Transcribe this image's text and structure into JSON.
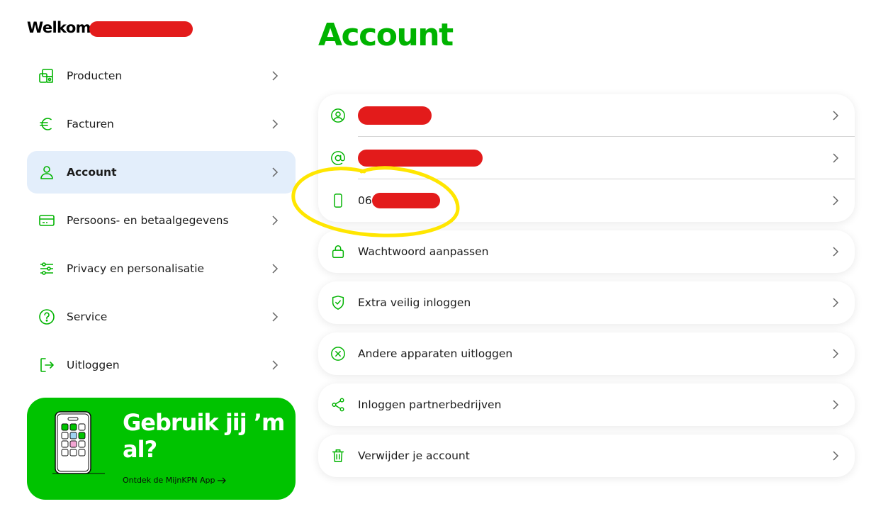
{
  "welcome": {
    "text": "Welkom"
  },
  "sidebar": {
    "items": [
      {
        "label": "Producten",
        "icon": "home-devices-icon",
        "active": false
      },
      {
        "label": "Facturen",
        "icon": "euro-icon",
        "active": false
      },
      {
        "label": "Account",
        "icon": "user-icon",
        "active": true
      },
      {
        "label": "Persoons- en betaalgegevens",
        "icon": "credit-card-icon",
        "active": false
      },
      {
        "label": "Privacy en personalisatie",
        "icon": "sliders-icon",
        "active": false
      },
      {
        "label": "Service",
        "icon": "help-circle-icon",
        "active": false
      },
      {
        "label": "Uitloggen",
        "icon": "logout-icon",
        "active": false
      }
    ]
  },
  "promo": {
    "title": "Gebruik jij ’m al?",
    "link": "Ontdek de MijnKPN App"
  },
  "main": {
    "title": "Account",
    "contact_rows": [
      {
        "icon": "user-circle-icon",
        "prefix": "",
        "redacted": true
      },
      {
        "icon": "at-sign-icon",
        "prefix": "",
        "redacted": true
      },
      {
        "icon": "mobile-phone-icon",
        "prefix": "06",
        "redacted": true
      }
    ],
    "rows": [
      {
        "label": "Wachtwoord aanpassen",
        "icon": "lock-icon"
      },
      {
        "label": "Extra veilig inloggen",
        "icon": "shield-check-icon"
      },
      {
        "label": "Andere apparaten uitloggen",
        "icon": "x-circle-icon"
      },
      {
        "label": "Inloggen partnerbedrijven",
        "icon": "share-icon"
      },
      {
        "label": "Verwijder je account",
        "icon": "trash-icon"
      }
    ]
  },
  "colors": {
    "brand_green": "#00c300",
    "title_green": "#00b300",
    "active_bg": "#e3eefb",
    "redaction": "#e31b1b",
    "highlight": "#ffe600"
  }
}
